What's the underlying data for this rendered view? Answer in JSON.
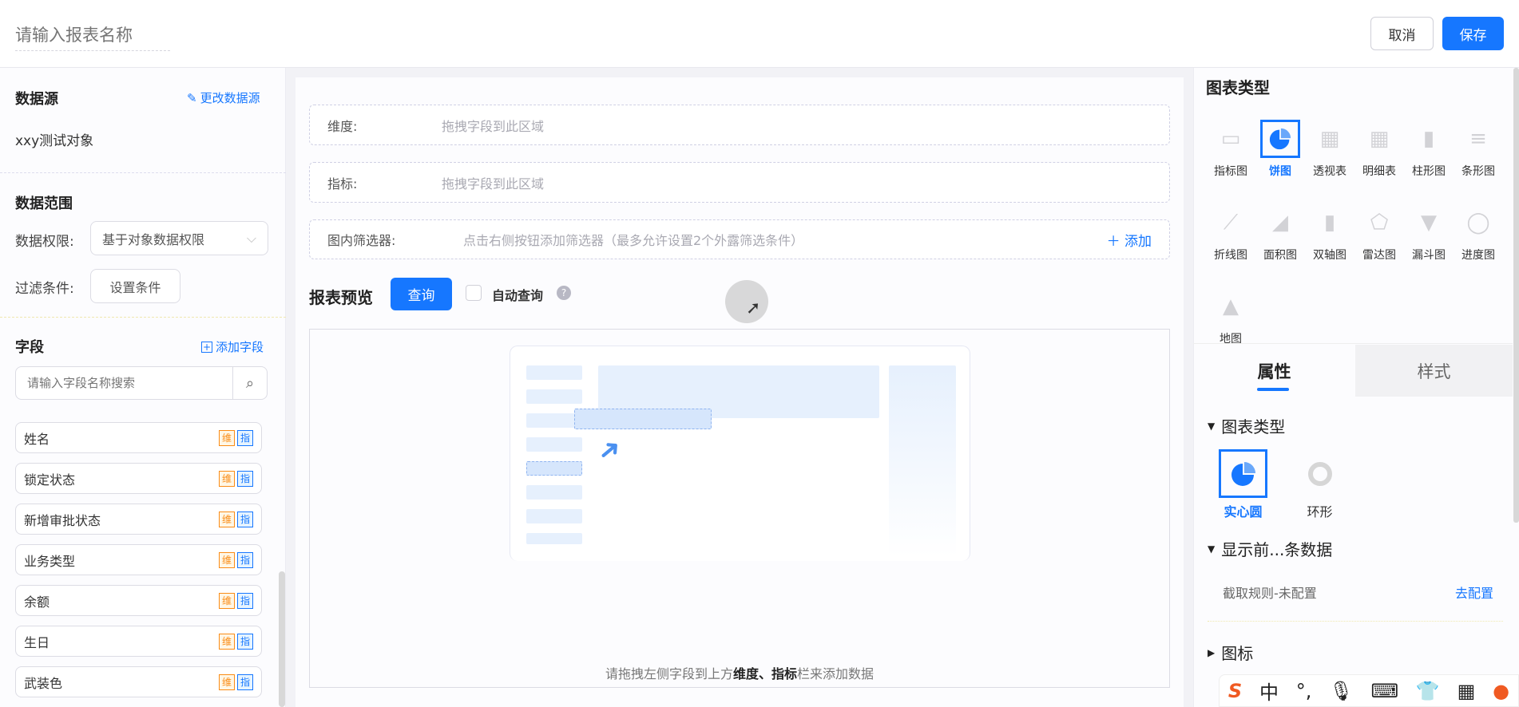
{
  "header": {
    "title_placeholder": "请输入报表名称",
    "cancel": "取消",
    "save": "保存"
  },
  "left": {
    "datasource": {
      "title": "数据源",
      "change_link": "更改数据源",
      "value": "xxy测试对象"
    },
    "scope": {
      "title": "数据范围",
      "permission_label": "数据权限:",
      "permission_value": "基于对象数据权限",
      "filter_label": "过滤条件:",
      "filter_button": "设置条件"
    },
    "fields": {
      "title": "字段",
      "add_link": "添加字段",
      "search_placeholder": "请输入字段名称搜索",
      "dim_tag": "维",
      "metric_tag": "指",
      "items": [
        "姓名",
        "锁定状态",
        "新增审批状态",
        "业务类型",
        "余额",
        "生日",
        "武装色"
      ]
    }
  },
  "center": {
    "dimension": {
      "label": "维度:",
      "placeholder": "拖拽字段到此区域"
    },
    "metric": {
      "label": "指标:",
      "placeholder": "拖拽字段到此区域"
    },
    "filter": {
      "label": "图内筛选器:",
      "placeholder": "点击右侧按钮添加筛选器（最多允许设置2个外露筛选条件）",
      "add": "添加"
    },
    "preview": {
      "title": "报表预览",
      "query": "查询",
      "auto_query": "自动查询",
      "hint_pre": "请拖拽左侧字段到上方",
      "hint_bold": "维度、指标",
      "hint_post": "栏来添加数据"
    }
  },
  "right": {
    "chart_type_title": "图表类型",
    "chart_types": [
      "指标图",
      "饼图",
      "透视表",
      "明细表",
      "柱形图",
      "条形图",
      "折线图",
      "面积图",
      "双轴图",
      "雷达图",
      "漏斗图",
      "进度图",
      "地图"
    ],
    "selected_chart": "饼图",
    "tabs": {
      "props": "属性",
      "style": "样式"
    },
    "section_chart_type": "图表类型",
    "pie_options": [
      "实心圆",
      "环形"
    ],
    "section_topn": "显示前...条数据",
    "topn_rule": "截取规则-未配置",
    "topn_config": "去配置",
    "section_icon": "图标"
  },
  "ime": {
    "lang": "中",
    "punct": "°,"
  },
  "colors": {
    "primary": "#1677ff",
    "dim_tag": "#fa8c16"
  }
}
